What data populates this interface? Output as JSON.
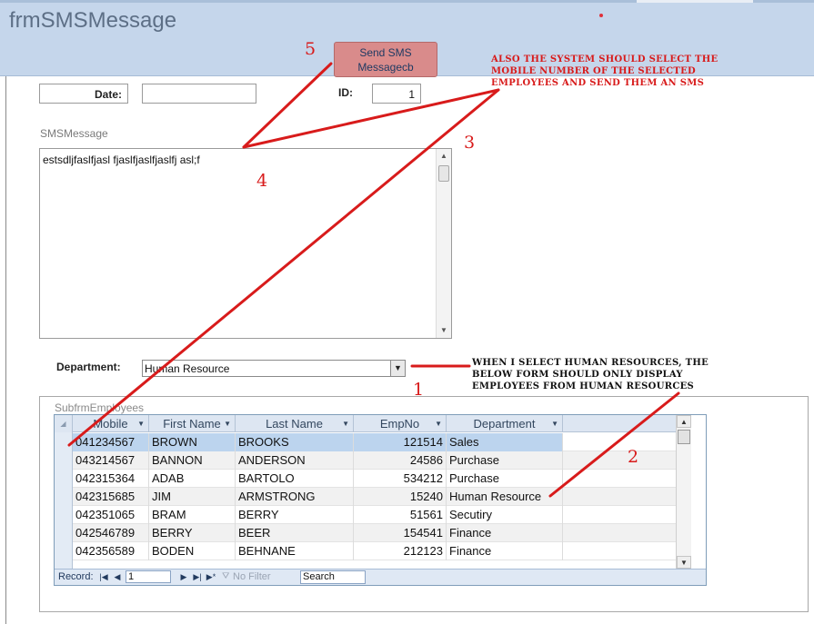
{
  "window": {
    "title": "frmSMSMessage"
  },
  "header": {
    "send_button": [
      "Send SMS",
      "Messagecb"
    ]
  },
  "form": {
    "date_label": "Date:",
    "date_value": "",
    "id_label": "ID:",
    "id_value": "1",
    "sms_label": "SMSMessage",
    "sms_text": "estsdljfaslfjasl fjaslfjaslfjaslfj asl;f",
    "department_label": "Department:",
    "department_value": "Human Resource"
  },
  "subform": {
    "label": "SubfrmEmployees",
    "columns": [
      "Mobile",
      "First Name",
      "Last Name",
      "EmpNo",
      "Department"
    ],
    "rows": [
      [
        "041234567",
        "BROWN",
        "BROOKS",
        "121514",
        "Sales"
      ],
      [
        "043214567",
        "BANNON",
        "ANDERSON",
        "24586",
        "Purchase"
      ],
      [
        "042315364",
        "ADAB",
        "BARTOLO",
        "534212",
        "Purchase"
      ],
      [
        "042315685",
        "JIM",
        "ARMSTRONG",
        "15240",
        "Human Resource"
      ],
      [
        "042351065",
        "BRAM",
        "BERRY",
        "51561",
        "Secutiry"
      ],
      [
        "042546789",
        "BERRY",
        "BEER",
        "154541",
        "Finance"
      ],
      [
        "042356589",
        "BODEN",
        "BEHNANE",
        "212123",
        "Finance"
      ]
    ],
    "nav": {
      "record_label": "Record:",
      "record_value": "1",
      "no_filter": "No Filter",
      "search": "Search"
    }
  },
  "annotations": {
    "n1": "1",
    "n2": "2",
    "n3": "3",
    "n4": "4",
    "n5": "5",
    "note_top": [
      "Also the system should select the",
      "mobile number of the selected",
      "employees and send them an SMS"
    ],
    "note_mid": [
      "When I select Human resources, the",
      "below form should only display",
      "employees from human resources"
    ]
  },
  "colors": {
    "annotation": "#d81b1b",
    "header_bg": "#c5d6eb",
    "button_bg": "#d98b8b"
  }
}
